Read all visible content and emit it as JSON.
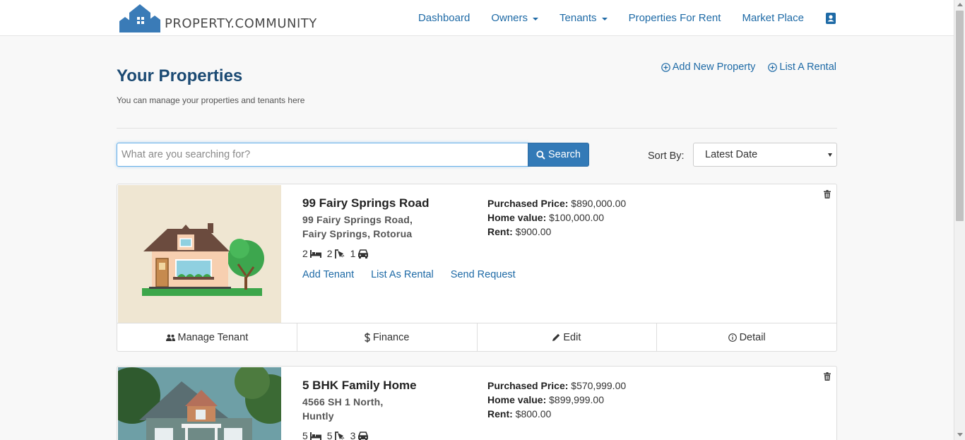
{
  "brand": {
    "name": "PROPERTY.COMMUNITY",
    "accent": "#337ab7",
    "link_color": "#1e6aa6"
  },
  "nav": {
    "items": [
      {
        "label": "Dashboard",
        "dropdown": false
      },
      {
        "label": "Owners",
        "dropdown": true
      },
      {
        "label": "Tenants",
        "dropdown": true
      },
      {
        "label": "Properties For Rent",
        "dropdown": false
      },
      {
        "label": "Market Place",
        "dropdown": false
      }
    ],
    "profile_icon": "contact-card-icon"
  },
  "header": {
    "title": "Your Properties",
    "subtitle": "You can manage your properties and tenants here",
    "actions": [
      {
        "label": "Add New Property",
        "icon": "plus-circle-icon"
      },
      {
        "label": "List A Rental",
        "icon": "plus-circle-icon"
      }
    ]
  },
  "search": {
    "placeholder": "What are you searching for?",
    "value": "",
    "button_label": "Search"
  },
  "sort": {
    "label": "Sort By:",
    "selected": "Latest Date"
  },
  "properties": [
    {
      "name": "99 Fairy Springs Road",
      "address_line1": "99 Fairy Springs Road,",
      "address_line2": "Fairy Springs, Rotorua",
      "beds": "2",
      "baths": "2",
      "parking": "1",
      "purchased_label": "Purchased Price:",
      "purchased_value": "$890,000.00",
      "home_value_label": "Home value:",
      "home_value": "$100,000.00",
      "rent_label": "Rent:",
      "rent_value": "$900.00",
      "links": [
        "Add Tenant",
        "List As Rental",
        "Send Request"
      ],
      "footer": [
        "Manage Tenant",
        "Finance",
        "Edit",
        "Detail"
      ]
    },
    {
      "name": "5 BHK Family Home",
      "address_line1": "4566 SH 1 North,",
      "address_line2": "Huntly",
      "beds": "5",
      "baths": "5",
      "parking": "3",
      "purchased_label": "Purchased Price:",
      "purchased_value": "$570,999.00",
      "home_value_label": "Home value:",
      "home_value": "$899,999.00",
      "rent_label": "Rent:",
      "rent_value": "$800.00"
    }
  ]
}
